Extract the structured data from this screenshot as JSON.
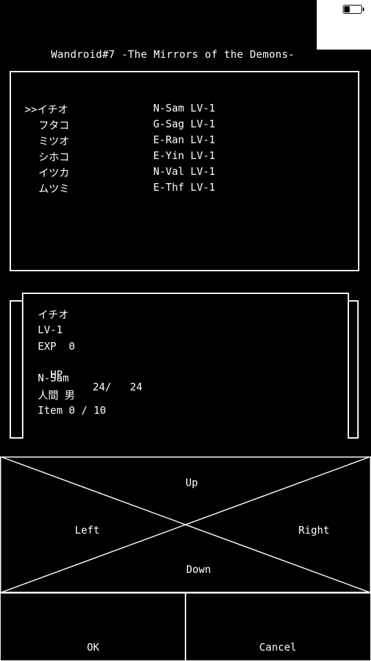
{
  "status_bar": {
    "battery_level": 0.35
  },
  "title": "Wandroid#7 -The Mirrors of the Demons-",
  "party": {
    "cursor": ">>",
    "members": [
      {
        "name": "イチオ",
        "class": "N-Sam LV-1"
      },
      {
        "name": "フタコ",
        "class": "G-Sag LV-1"
      },
      {
        "name": "ミツオ",
        "class": "E-Ran LV-1"
      },
      {
        "name": "シホコ",
        "class": "E-Yin LV-1"
      },
      {
        "name": "イツカ",
        "class": "N-Val LV-1"
      },
      {
        "name": "ムツミ",
        "class": "E-Thf LV-1"
      }
    ]
  },
  "detail": {
    "name": "イチオ",
    "level": "LV-1",
    "exp": "EXP  0",
    "hp_label": "HP",
    "hp_value": "24/   24",
    "class": "N-Sam",
    "race_gender": "人間 男",
    "items": "Item 0 / 10"
  },
  "controls": {
    "up": "Up",
    "down": "Down",
    "left": "Left",
    "right": "Right",
    "ok": "OK",
    "cancel": "Cancel"
  }
}
